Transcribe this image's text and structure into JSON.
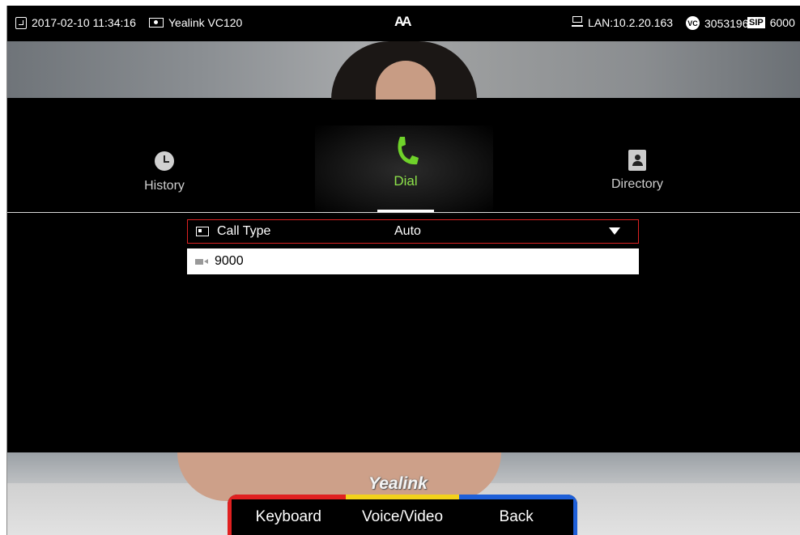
{
  "status_bar": {
    "datetime": "2017-02-10 11:34:16",
    "device_name": "Yealink VC120",
    "font_icon": "AA",
    "lan": "LAN:10.2.20.163",
    "vc_badge": "VC",
    "vc_number": "3053196",
    "sip_badge": "SIP",
    "sip_number": "6000"
  },
  "tabs": [
    {
      "label": "History",
      "icon": "clock-icon"
    },
    {
      "label": "Dial",
      "icon": "phone-icon",
      "selected": true,
      "accent": "#8de24a"
    },
    {
      "label": "Directory",
      "icon": "directory-icon"
    }
  ],
  "form": {
    "call_type_label": "Call Type",
    "call_type_value": "Auto",
    "number_value": "9000"
  },
  "watermark": "Yealink",
  "softkeys": [
    {
      "label": "Keyboard",
      "color": "#e02020"
    },
    {
      "label": "Voice/Video",
      "color": "#f2d21b"
    },
    {
      "label": "Back",
      "color": "#1e5fd8"
    }
  ]
}
